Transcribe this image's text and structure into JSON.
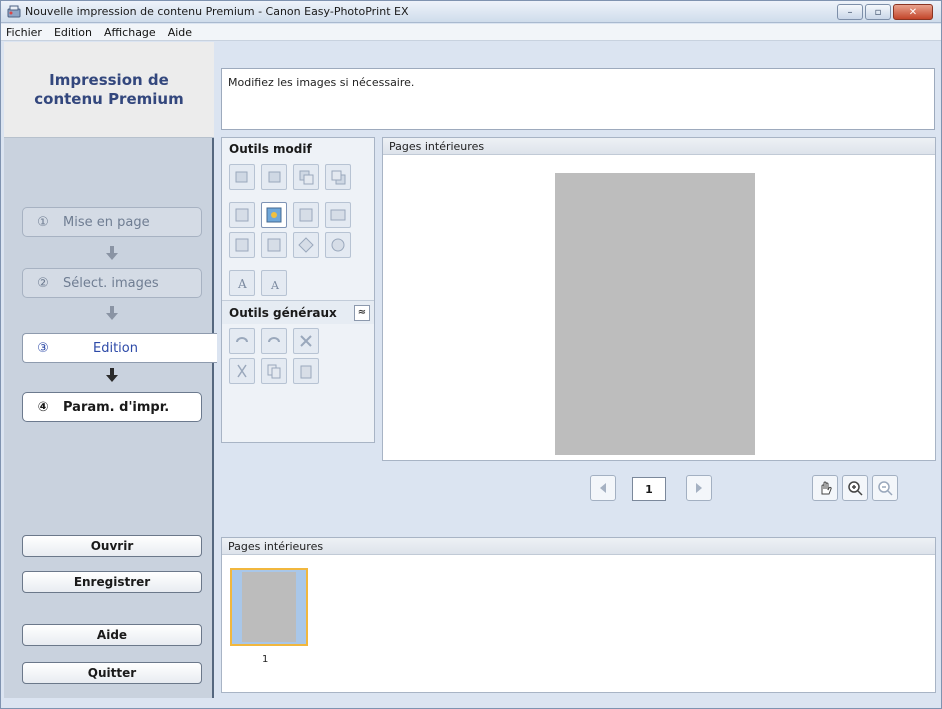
{
  "window": {
    "title": "Nouvelle impression de contenu Premium - Canon Easy-PhotoPrint EX"
  },
  "menu": [
    "Fichier",
    "Edition",
    "Affichage",
    "Aide"
  ],
  "sidebar": {
    "header": "Impression de contenu Premium",
    "steps": [
      {
        "num": "①",
        "label": "Mise en page"
      },
      {
        "num": "②",
        "label": "Sélect. images"
      },
      {
        "num": "③",
        "label": "Edition"
      },
      {
        "num": "④",
        "label": "Param. d'impr."
      }
    ],
    "buttons": {
      "open": "Ouvrir",
      "save": "Enregistrer",
      "help": "Aide",
      "quit": "Quitter"
    }
  },
  "main": {
    "instruction": "Modifiez les images si nécessaire.",
    "tools_title": "Outils modif",
    "general_tools_title": "Outils généraux",
    "collapse_glyph": "≈",
    "preview_title": "Pages intérieures",
    "page_number": "1",
    "thumbnails_title": "Pages intérieures",
    "thumbnail_label": "1"
  },
  "colors": {
    "accent": "#33477d",
    "active_step": "#2d4aa8",
    "page_placeholder": "#bdbdbd",
    "thumb_selected": "#f1b73e"
  }
}
